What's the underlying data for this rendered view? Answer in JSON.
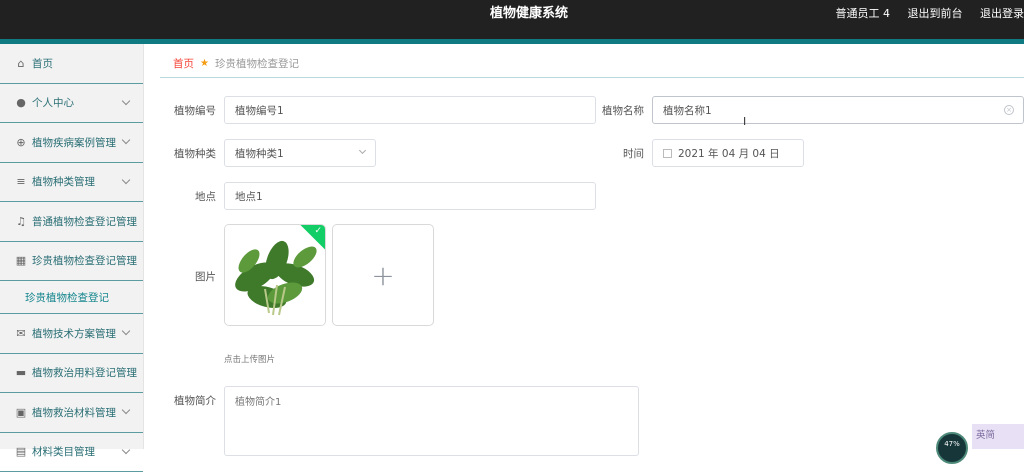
{
  "header": {
    "title": "植物健康系统",
    "user": "普通员工 4",
    "back_to_front": "退出到前台",
    "logout": "退出登录"
  },
  "sidebar": {
    "items": [
      {
        "label": "首页",
        "icon": "home-icon",
        "glyph": "⌂",
        "chevron": false
      },
      {
        "label": "个人中心",
        "icon": "user-icon",
        "glyph": "●",
        "chevron": true
      },
      {
        "label": "植物疾病案例管理",
        "icon": "globe-icon",
        "glyph": "⊕",
        "chevron": true
      },
      {
        "label": "植物种类管理",
        "icon": "list-icon",
        "glyph": "≡",
        "chevron": true
      },
      {
        "label": "普通植物检查登记管理",
        "icon": "bell-icon",
        "glyph": "♫",
        "chevron": false
      },
      {
        "label": "珍贵植物检查登记管理",
        "icon": "grid-icon",
        "glyph": "▦",
        "chevron": false
      },
      {
        "label": "植物技术方案管理",
        "icon": "mail-icon",
        "glyph": "✉",
        "chevron": true
      },
      {
        "label": "植物救治用料登记管理",
        "icon": "box-icon",
        "glyph": "▬",
        "chevron": false
      },
      {
        "label": "植物救治材料管理",
        "icon": "chart-icon",
        "glyph": "▣",
        "chevron": true
      },
      {
        "label": "材料类目管理",
        "icon": "folder-icon",
        "glyph": "▤",
        "chevron": true
      }
    ],
    "sub_item": "珍贵植物检查登记"
  },
  "breadcrumb": {
    "home": "首页",
    "current": "珍贵植物检查登记"
  },
  "form": {
    "plant_no": {
      "label": "植物编号",
      "value": "植物编号1"
    },
    "plant_name": {
      "label": "植物名称",
      "value": "植物名称1"
    },
    "plant_type": {
      "label": "植物种类",
      "value": "植物种类1"
    },
    "time": {
      "label": "时间",
      "value": "2021 年 04 月 04 日"
    },
    "location": {
      "label": "地点",
      "value": "地点1"
    },
    "image": {
      "label": "图片",
      "hint": "点击上传图片"
    },
    "intro": {
      "label": "植物简介",
      "value": "植物简介1"
    }
  },
  "widgets": {
    "progress": "47%",
    "language": "英简"
  },
  "colors": {
    "header_bg": "#212121",
    "teal_accent": "#0f7a81",
    "menu_text": "#2a6f75",
    "breadcrumb_home": "#f44336",
    "upload_success": "#13ce66"
  }
}
